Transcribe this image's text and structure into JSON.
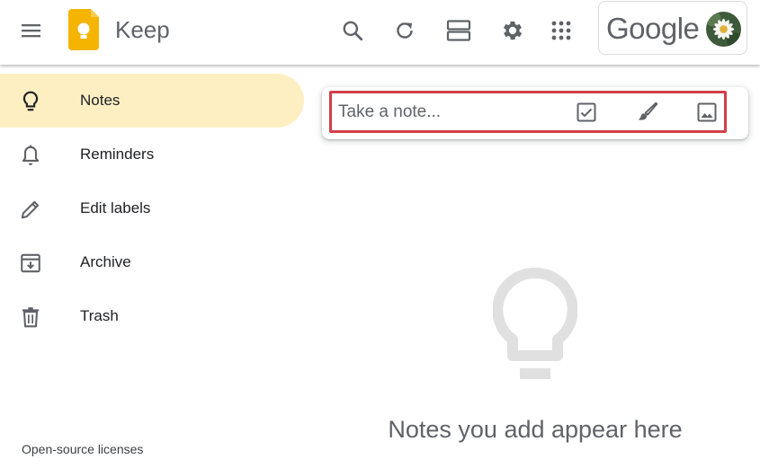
{
  "header": {
    "app_title": "Keep",
    "menu_icon": "hamburger-menu-icon",
    "logo_icon": "keep-bulb-logo",
    "actions": [
      {
        "name": "search-icon",
        "label": "Search"
      },
      {
        "name": "refresh-icon",
        "label": "Refresh"
      },
      {
        "name": "list-view-icon",
        "label": "List view"
      },
      {
        "name": "settings-gear-icon",
        "label": "Settings"
      },
      {
        "name": "apps-grid-icon",
        "label": "Google apps"
      }
    ],
    "account": {
      "brand": "Google",
      "avatar": "daisy-flower-avatar"
    }
  },
  "sidebar": {
    "items": [
      {
        "label": "Notes",
        "icon": "lightbulb-icon",
        "active": true
      },
      {
        "label": "Reminders",
        "icon": "bell-icon",
        "active": false
      },
      {
        "label": "Edit labels",
        "icon": "pencil-icon",
        "active": false
      },
      {
        "label": "Archive",
        "icon": "archive-icon",
        "active": false
      },
      {
        "label": "Trash",
        "icon": "trash-icon",
        "active": false
      }
    ],
    "footer_link": "Open-source licenses"
  },
  "note_input": {
    "placeholder": "Take a note...",
    "tools": [
      {
        "name": "new-list-checkbox-icon",
        "label": "New list"
      },
      {
        "name": "new-drawing-brush-icon",
        "label": "New note with drawing"
      },
      {
        "name": "new-image-icon",
        "label": "New note with image"
      }
    ]
  },
  "empty_state": {
    "icon": "large-lightbulb-icon",
    "message": "Notes you add appear here"
  },
  "colors": {
    "active_nav_bg": "#feefc3",
    "highlight_border": "#d1404a",
    "logo_yellow": "#f4b400",
    "icon_gray": "#5f6368",
    "empty_icon_gray": "#e0e0e0"
  }
}
